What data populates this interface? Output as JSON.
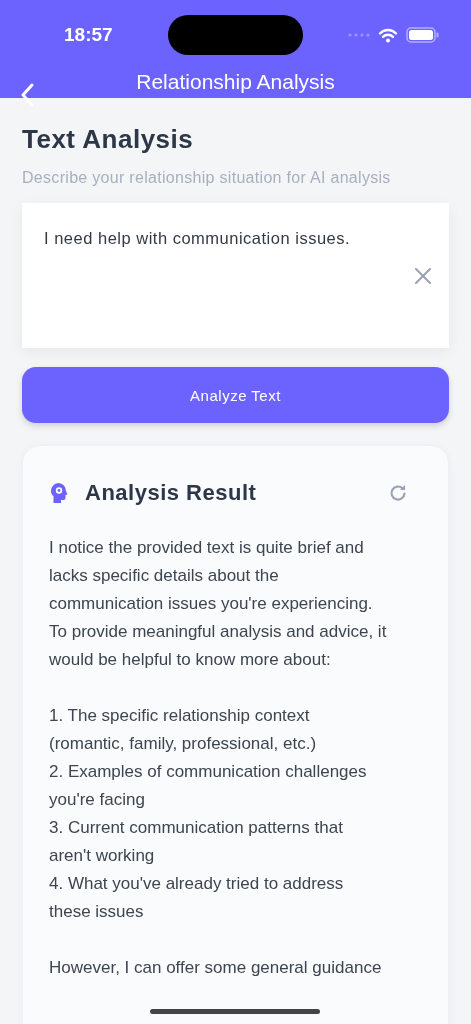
{
  "status_bar": {
    "time": "18:57"
  },
  "nav": {
    "title": "Relationship Analysis"
  },
  "section": {
    "title": "Text Analysis",
    "subtitle": "Describe your relationship situation for AI analysis"
  },
  "input": {
    "value": "I need help with communication issues."
  },
  "analyze_button": {
    "label": "Analyze Text"
  },
  "result": {
    "title": "Analysis Result",
    "paragraphs": [
      {
        "lines": [
          "I notice the provided text is quite brief and",
          "lacks specific details about the",
          "communication issues you're experiencing.",
          "To provide meaningful analysis and advice, it",
          "would be helpful to know more about:"
        ]
      },
      {
        "lines": [
          "1. The specific relationship context",
          "(romantic, family, professional, etc.)",
          "2. Examples of communication challenges",
          "you're facing",
          "3. Current communication patterns that",
          "aren't working",
          "4. What you've already tried to address",
          "these issues"
        ]
      },
      {
        "lines": [
          "However, I can offer some general guidance"
        ]
      }
    ]
  }
}
